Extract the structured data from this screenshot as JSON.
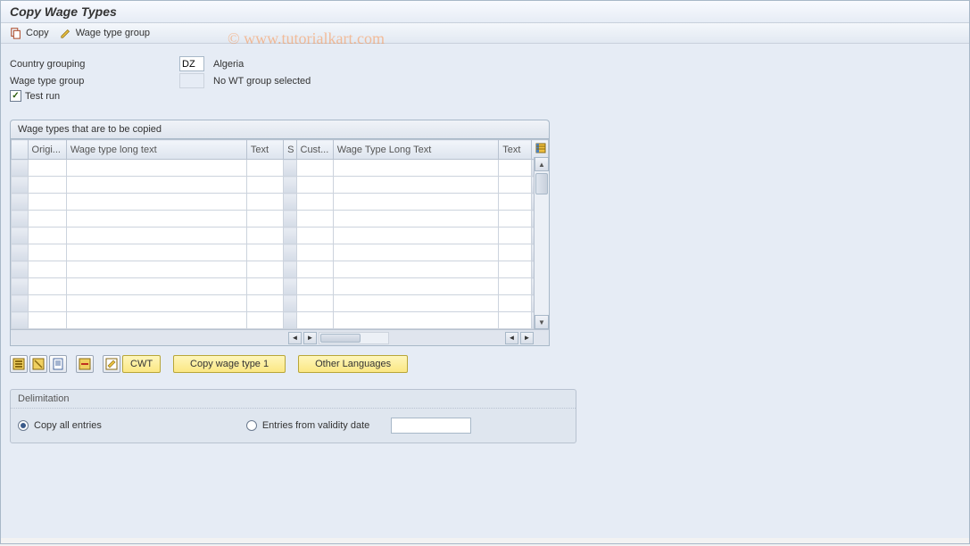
{
  "title": "Copy Wage Types",
  "watermark": "© www.tutorialkart.com",
  "toolbar": {
    "copy_label": "Copy",
    "wage_type_group_label": "Wage type group"
  },
  "form": {
    "country_grouping_label": "Country grouping",
    "country_grouping_value": "DZ",
    "country_grouping_desc": "Algeria",
    "wage_type_group_label": "Wage type group",
    "wage_type_group_value": "",
    "wage_type_group_desc": "No WT group selected",
    "test_run_label": "Test run",
    "test_run_checked": true
  },
  "table": {
    "title": "Wage types that are to be copied",
    "columns": {
      "origi": "Origi...",
      "wtlt": "Wage type long text",
      "text1": "Text",
      "s": "S",
      "cust": "Cust...",
      "wtlt2": "Wage Type Long Text",
      "text2": "Text"
    },
    "rows": 10
  },
  "actions": {
    "cwt_label": "CWT",
    "copy_wt1_label": "Copy wage type 1",
    "other_lang_label": "Other Languages"
  },
  "delimitation": {
    "title": "Delimitation",
    "copy_all_label": "Copy all entries",
    "entries_from_label": "Entries from validity date",
    "selected": "copy_all",
    "date_value": ""
  }
}
